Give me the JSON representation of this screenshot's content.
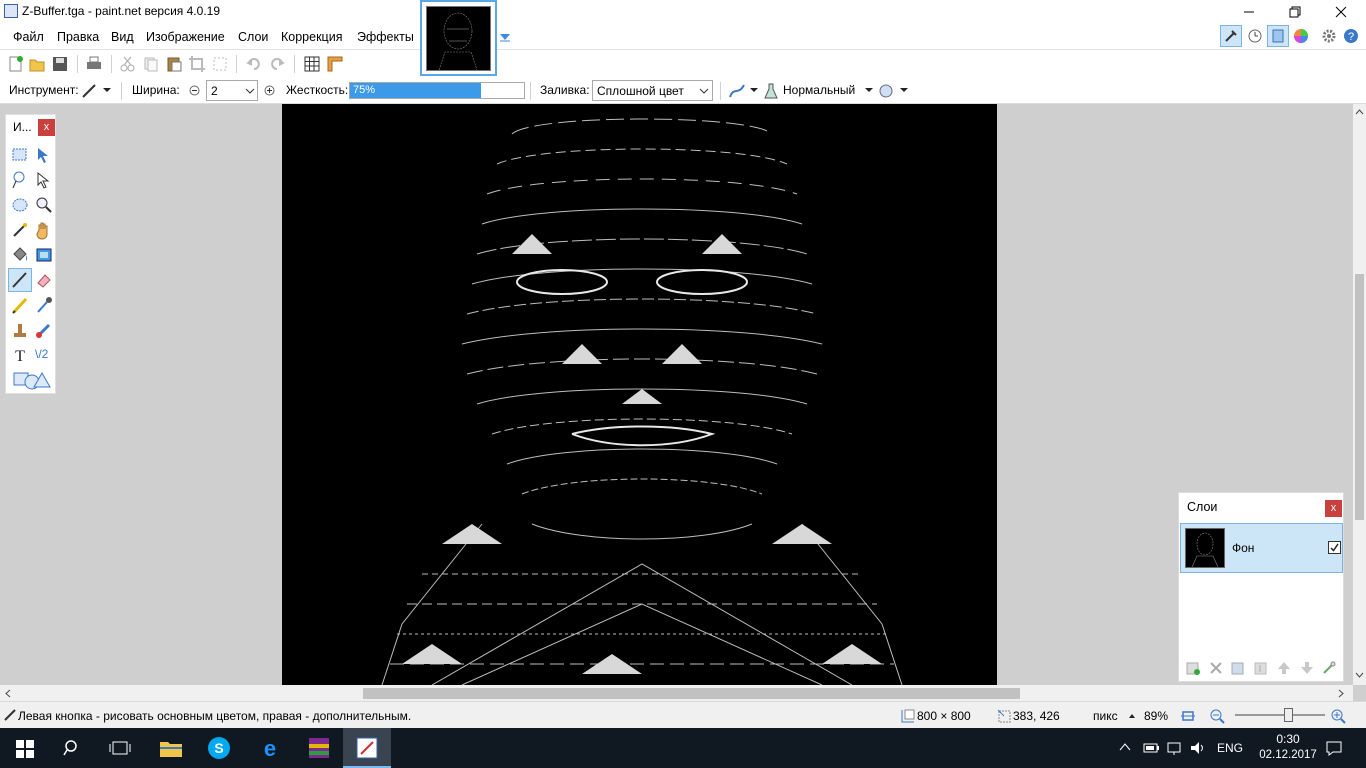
{
  "window": {
    "title": "Z-Buffer.tga - paint.net версия 4.0.19",
    "controls": [
      "minimize",
      "maximize",
      "close"
    ]
  },
  "menu": [
    "Файл",
    "Правка",
    "Вид",
    "Изображение",
    "Слои",
    "Коррекция",
    "Эффекты"
  ],
  "toolbar": {
    "tool_label": "Инструмент:",
    "width_label": "Ширина:",
    "width_value": "2",
    "hardness_label": "Жесткость:",
    "hardness_value": "75%",
    "hardness_fraction": 0.75,
    "fill_label": "Заливка:",
    "fill_value": "Сплошной цвет",
    "blend_value": "Нормальный"
  },
  "tools_panel": {
    "title": "И...",
    "close": "x",
    "icons": [
      "rect-select-icon",
      "move-selection-icon",
      "lasso-icon",
      "move-selected-icon",
      "ellipse-select-icon",
      "zoom-icon",
      "magic-wand-icon",
      "pan-icon",
      "paint-bucket-icon",
      "gradient-icon",
      "paintbrush-icon",
      "eraser-icon",
      "pencil-icon",
      "color-picker-icon",
      "clone-stamp-icon",
      "recolor-icon",
      "text-icon",
      "line-curve-icon",
      "shapes-icon"
    ],
    "line_tool_label": "\\/2"
  },
  "layers_panel": {
    "title": "Слои",
    "close": "x",
    "layers": [
      {
        "name": "Фон",
        "visible": true
      }
    ]
  },
  "status": {
    "hint": "Левая кнопка - рисовать основным цветом, правая - дополнительным.",
    "image_size": "800 × 800",
    "cursor_pos": "383, 426",
    "units": "пикс",
    "zoom": "89%",
    "zoom_slider_fraction": 0.6
  },
  "taskbar": {
    "lang": "ENG",
    "time": "0:30",
    "date": "02.12.2017"
  },
  "colors": {
    "accent": "#3c8ce4",
    "close_red": "#c9403d",
    "taskbar": "#101822"
  }
}
